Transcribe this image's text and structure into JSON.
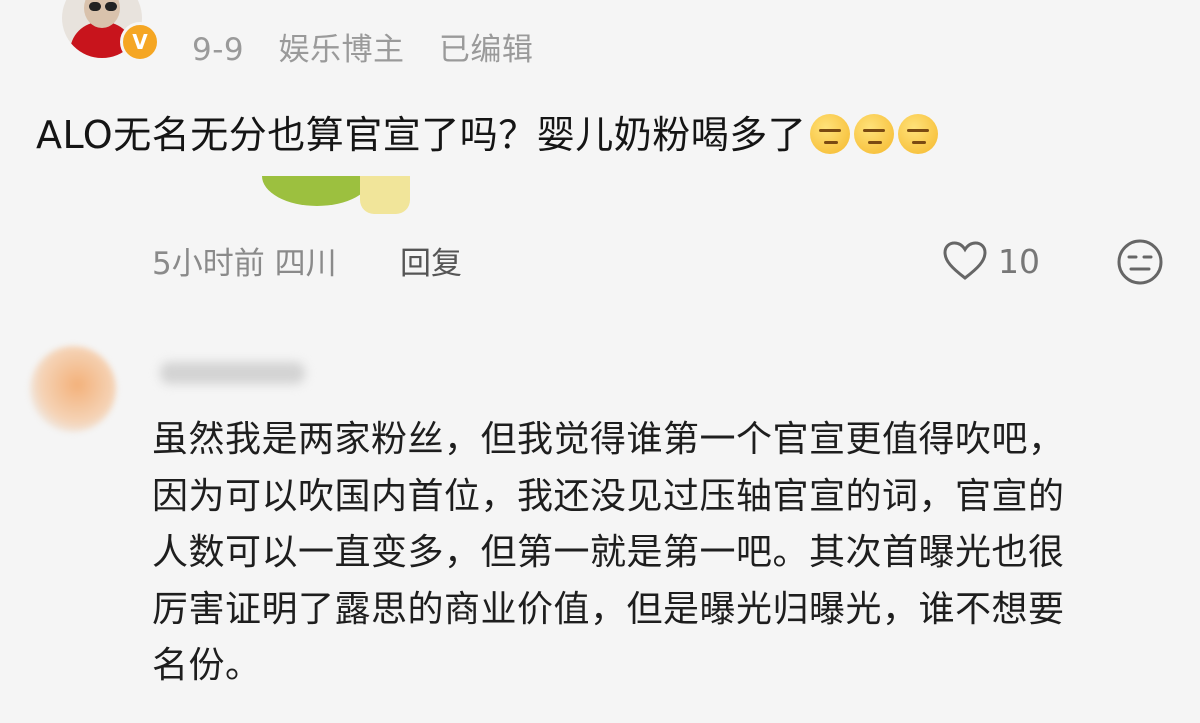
{
  "post": {
    "date": "9-9",
    "author_tag": "娱乐博主",
    "edited": "已编辑",
    "verified_badge": "V",
    "text": "ALO无名无分也算官宣了吗？婴儿奶粉喝多了",
    "emojis": [
      "thinking-face",
      "thinking-face",
      "thinking-face"
    ],
    "time": "5小时前",
    "location": "四川",
    "reply_label": "回复",
    "like_count": "10"
  },
  "comment": {
    "lines": [
      "虽然我是两家粉丝，但我觉得谁第一个官宣更值得吹吧，",
      "因为可以吹国内首位，我还没见过压轴官宣的词，官宣的",
      "人数可以一直变多，但第一就是第一吧。其次首曝光也很",
      "厉害证明了露思的商业价值，但是曝光归曝光，谁不想要",
      "名份。"
    ]
  },
  "colors": {
    "background": "#f5f5f5",
    "verified_badge": "#f5a623",
    "meta_text": "#9a9a9a"
  }
}
